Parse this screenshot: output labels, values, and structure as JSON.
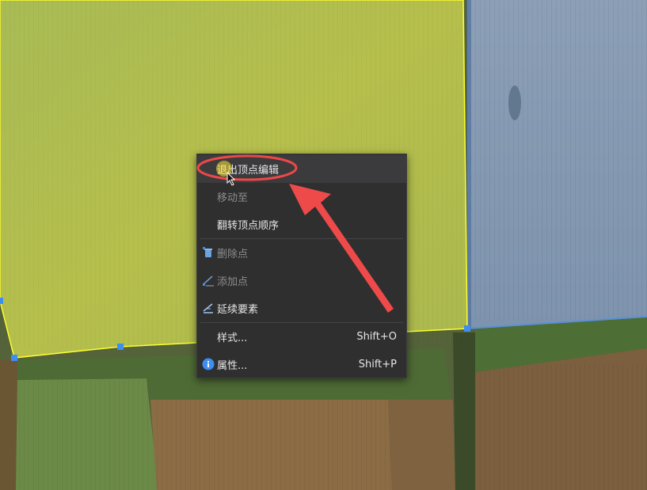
{
  "context_menu": {
    "items": [
      {
        "label": "退出顶点编辑",
        "shortcut": "",
        "enabled": true,
        "icon": ""
      },
      {
        "label": "移动至",
        "shortcut": "",
        "enabled": false,
        "icon": ""
      },
      {
        "label": "翻转顶点顺序",
        "shortcut": "",
        "enabled": true,
        "icon": ""
      },
      {
        "label": "删除点",
        "shortcut": "",
        "enabled": false,
        "icon": "delete-vertex-icon"
      },
      {
        "label": "添加点",
        "shortcut": "",
        "enabled": false,
        "icon": "add-vertex-icon"
      },
      {
        "label": "延续要素",
        "shortcut": "",
        "enabled": true,
        "icon": "continue-feature-icon"
      },
      {
        "label": "样式...",
        "shortcut": "Shift+O",
        "enabled": true,
        "icon": ""
      },
      {
        "label": "属性...",
        "shortcut": "Shift+P",
        "enabled": true,
        "icon": "info-icon"
      }
    ]
  },
  "colors": {
    "selected_polygon_fill": "#c9d13c",
    "selected_polygon_edge": "#ffff2a",
    "other_polygon_fill": "#5b86c6",
    "vertex_handle": "#3d8ef0",
    "annotation": "#ec4848",
    "menu_background": "#2f2f30"
  }
}
